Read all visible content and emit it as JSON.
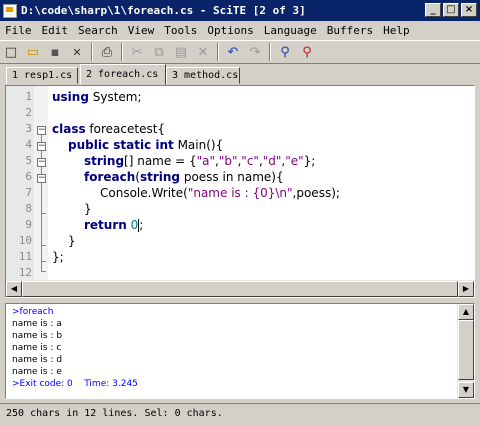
{
  "window": {
    "title": "D:\\code\\sharp\\1\\foreach.cs - SciTE [2 of 3]",
    "buttons": {
      "minimize": "_",
      "maximize": "□",
      "close": "×"
    }
  },
  "menu": [
    "File",
    "Edit",
    "Search",
    "View",
    "Tools",
    "Options",
    "Language",
    "Buffers",
    "Help"
  ],
  "toolbar": [
    {
      "name": "new-file-icon",
      "glyph": "□"
    },
    {
      "name": "open-folder-icon",
      "glyph": "▭"
    },
    {
      "name": "save-icon",
      "glyph": "▪"
    },
    {
      "name": "close-file-icon",
      "glyph": "✕"
    },
    {
      "name": "print-icon",
      "glyph": "⎙"
    },
    {
      "name": "cut-icon",
      "glyph": "✂"
    },
    {
      "name": "copy-icon",
      "glyph": "⧉"
    },
    {
      "name": "paste-icon",
      "glyph": "▤"
    },
    {
      "name": "delete-icon",
      "glyph": "✕"
    },
    {
      "name": "undo-icon",
      "glyph": "↶"
    },
    {
      "name": "redo-icon",
      "glyph": "↷"
    },
    {
      "name": "find-icon",
      "glyph": "⚲"
    },
    {
      "name": "replace-icon",
      "glyph": "⚲"
    }
  ],
  "tabs": [
    "1 resp1.cs",
    "2 foreach.cs",
    "3 method.cs"
  ],
  "active_tab": 1,
  "editor": {
    "line_numbers": [
      "1",
      "2",
      "3",
      "4",
      "5",
      "6",
      "7",
      "8",
      "9",
      "10",
      "11",
      "12"
    ],
    "code": {
      "l1_kw": "using",
      "l1_rest": " System;",
      "l3_kw": "class",
      "l3_rest": " foreacetest{",
      "l4_kw": "public static int",
      "l4_rest": " Main(){",
      "l5_kw": "string",
      "l5_a": "[] name = {",
      "l5_s1": "\"a\"",
      "l5_c1": ",",
      "l5_s2": "\"b\"",
      "l5_c2": ",",
      "l5_s3": "\"c\"",
      "l5_c3": ",",
      "l5_s4": "\"d\"",
      "l5_c4": ",",
      "l5_s5": "\"e\"",
      "l5_end": "};",
      "l6_kw": "foreach",
      "l6_a": "(",
      "l6_kw2": "string",
      "l6_rest": " poess in name){",
      "l7_a": "Console.Write(",
      "l7_str": "\"name is : {0}\\n\"",
      "l7_rest": ",poess);",
      "l8": "}",
      "l9_kw": "return",
      "l9_sp": " ",
      "l9_num": "0",
      "l9_end": ";",
      "l10": "}",
      "l11": "};"
    }
  },
  "output": {
    "lines": [
      "name is : a",
      "name is : b",
      "name is : c",
      "name is : d",
      "name is : e"
    ],
    "command": ">foreach",
    "exit": ">Exit code: 0    Time: 3.245"
  },
  "status": "250 chars in 12 lines. Sel: 0 chars.",
  "colors": {
    "keyword": "#00007f",
    "string": "#7f007f",
    "number": "#007f7f",
    "output_info": "#0000ff",
    "titlebar": "#0a246a"
  }
}
